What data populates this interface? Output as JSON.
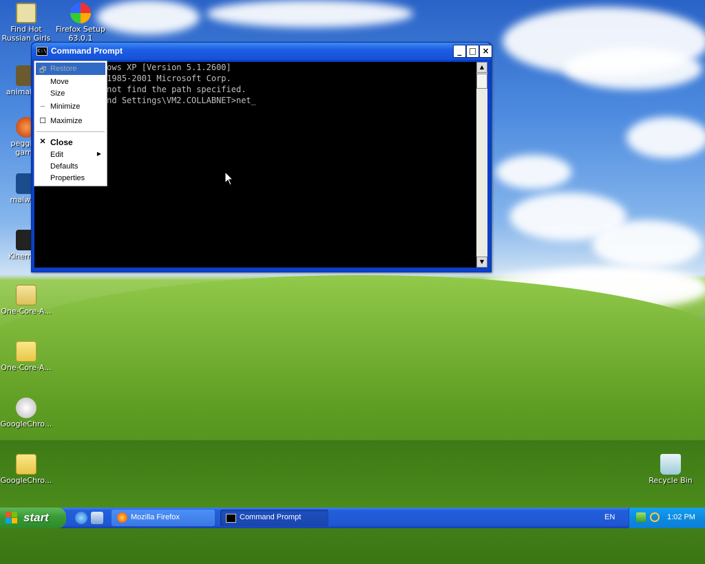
{
  "desktop": {
    "icons": [
      {
        "label": "Find Hot Russian Girls"
      },
      {
        "label": "Firefox Setup 63.0.1"
      },
      {
        "label": "animal a..."
      },
      {
        "label": "pegging game"
      },
      {
        "label": "malwa..."
      },
      {
        "label": "Kinema..."
      },
      {
        "label": "One-Core-A..."
      },
      {
        "label": "One-Core-A..."
      },
      {
        "label": "GoogleChro..."
      },
      {
        "label": "GoogleChro..."
      },
      {
        "label": "Recycle Bin"
      }
    ]
  },
  "window": {
    "title": "Command Prompt",
    "icon_text": "C:\\",
    "buttons": {
      "minimize": "_",
      "maximize": "□",
      "close": "×"
    },
    "console_lines": [
      "Microsoft Windows XP [Version 5.1.2600]",
      "(C) Copyright 1985-2001 Microsoft Corp.",
      "The system cannot find the path specified.",
      "",
      "C:\\Documents and Settings\\VM2.COLLABNET>net_"
    ]
  },
  "system_menu": {
    "items": [
      {
        "label": "Restore",
        "mark": "🗗",
        "disabled": true,
        "selected": true
      },
      {
        "label": "Move",
        "mark": ""
      },
      {
        "label": "Size",
        "mark": ""
      },
      {
        "label": "Minimize",
        "mark": "_"
      },
      {
        "label": "Maximize",
        "mark": "☐"
      },
      {
        "label": "Close",
        "mark": "✕",
        "bold": true
      },
      {
        "label": "Edit",
        "mark": "",
        "submenu": true
      },
      {
        "label": "Defaults",
        "mark": ""
      },
      {
        "label": "Properties",
        "mark": ""
      }
    ]
  },
  "taskbar": {
    "start_label": "start",
    "tasks": [
      {
        "label": "Mozilla Firefox"
      },
      {
        "label": "Command Prompt"
      }
    ],
    "language": "EN",
    "clock": "1:02 PM"
  }
}
